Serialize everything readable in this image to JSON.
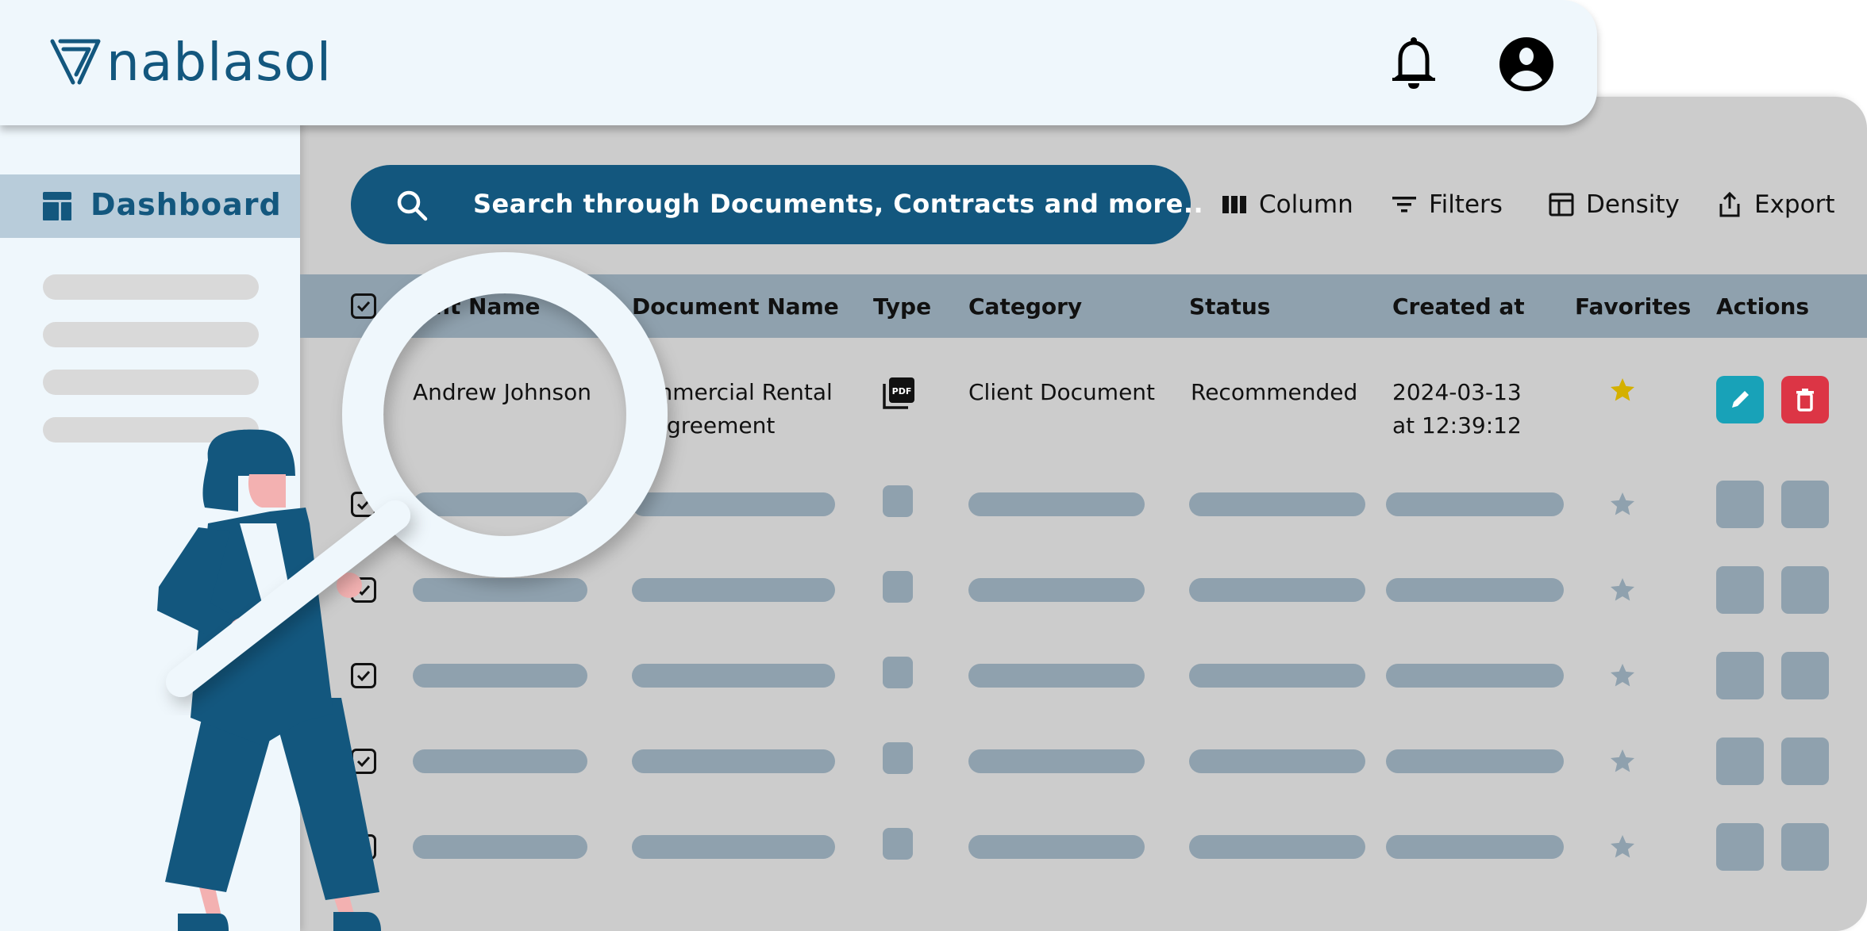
{
  "header": {
    "brand": "nablasol",
    "icons": [
      "bell-icon",
      "account-circle-icon"
    ]
  },
  "sidebar": {
    "active_item": {
      "label": "Dashboard",
      "icon": "dashboard-icon"
    },
    "placeholder_items": 4
  },
  "search": {
    "placeholder": "Search through Documents, Contracts and more..",
    "icon": "search-icon"
  },
  "toolbar": {
    "column_label": "Column",
    "filters_label": "Filters",
    "density_label": "Density",
    "export_label": "Export"
  },
  "table": {
    "columns": [
      "Client Name",
      "Document Name",
      "Type",
      "Category",
      "Status",
      "Created at",
      "Favorites",
      "Actions"
    ],
    "visible_header_fragment": "ent Name",
    "rows": [
      {
        "client_name": "Andrew Johnson",
        "document_name_line1": "mmercial Rental",
        "document_name_line2": "greement",
        "type": "PDF",
        "category": "Client Document",
        "status": "Recommended",
        "created_date": "2024-03-13",
        "created_time": "at 12:39:12",
        "favorite": true
      }
    ],
    "skeleton_rows": 5
  },
  "colors": {
    "brand": "#13577e",
    "header_bg": "#eff7fc",
    "panel_bg": "#cccccc",
    "table_header": "#8fa1ae",
    "favorite_star": "#d4b000",
    "edit_button": "#18a2b8",
    "delete_button": "#dc3545"
  }
}
